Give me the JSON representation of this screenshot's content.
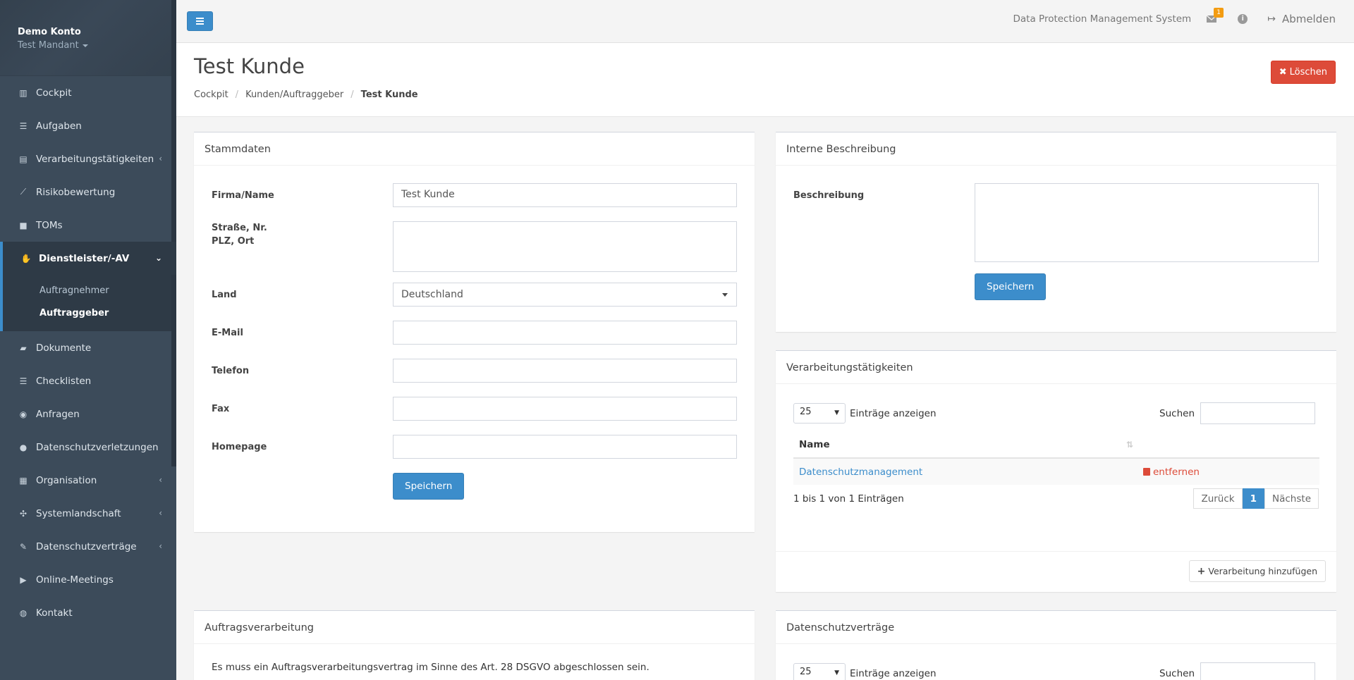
{
  "sidebar": {
    "account_name": "Demo Konto",
    "tenant": "Test Mandant",
    "items": [
      {
        "label": "Cockpit",
        "icon": "chart-icon"
      },
      {
        "label": "Aufgaben",
        "icon": "tasks-icon"
      },
      {
        "label": "Verarbeitungstätigkeiten",
        "icon": "list-icon"
      },
      {
        "label": "Risikobewertung",
        "icon": "line-chart-icon"
      },
      {
        "label": "TOMs",
        "icon": "lock-icon"
      },
      {
        "label": "Dienstleister/-AV",
        "icon": "handshake-icon"
      },
      {
        "label": "Dokumente",
        "icon": "folder-icon"
      },
      {
        "label": "Checklisten",
        "icon": "checklist-icon"
      },
      {
        "label": "Anfragen",
        "icon": "comments-icon"
      },
      {
        "label": "Datenschutzverletzungen",
        "icon": "alert-icon"
      },
      {
        "label": "Organisation",
        "icon": "building-icon"
      },
      {
        "label": "Systemlandschaft",
        "icon": "network-icon"
      },
      {
        "label": "Datenschutzverträge",
        "icon": "contract-icon"
      },
      {
        "label": "Online-Meetings",
        "icon": "video-icon"
      },
      {
        "label": "Kontakt",
        "icon": "globe-icon"
      }
    ],
    "sub_items": [
      "Auftragnehmer",
      "Auftraggeber"
    ]
  },
  "topbar": {
    "system_name": "Data Protection Management System",
    "mail_badge": "1",
    "logout": "Abmelden"
  },
  "page": {
    "title": "Test Kunde",
    "breadcrumb": [
      "Cockpit",
      "Kunden/Auftraggeber",
      "Test Kunde"
    ],
    "delete_label": "Löschen"
  },
  "stammdaten": {
    "title": "Stammdaten",
    "firma_label": "Firma/Name",
    "firma_value": "Test Kunde",
    "strasse_label": "Straße, Nr.",
    "plz_label": "PLZ, Ort",
    "land_label": "Land",
    "land_value": "Deutschland",
    "email_label": "E-Mail",
    "telefon_label": "Telefon",
    "fax_label": "Fax",
    "homepage_label": "Homepage",
    "save_label": "Speichern"
  },
  "interne": {
    "title": "Interne Beschreibung",
    "beschreibung_label": "Beschreibung",
    "save_label": "Speichern"
  },
  "verarbeitung": {
    "title": "Verarbeitungstätigkeiten",
    "length_value": "25",
    "length_label": "Einträge anzeigen",
    "search_label": "Suchen",
    "col_name": "Name",
    "rows": [
      {
        "name": "Datenschutzmanagement",
        "action": "entfernen"
      }
    ],
    "info": "1 bis 1 von 1 Einträgen",
    "prev": "Zurück",
    "page": "1",
    "next": "Nächste",
    "add_label": "Verarbeitung hinzufügen"
  },
  "auftrag": {
    "title": "Auftragsverarbeitung",
    "text": "Es muss ein Auftragsverarbeitungsvertrag im Sinne des Art. 28 DSGVO abgeschlossen sein."
  },
  "vertraege": {
    "title": "Datenschutzverträge",
    "length_value": "25",
    "length_label": "Einträge anzeigen",
    "search_label": "Suchen"
  }
}
